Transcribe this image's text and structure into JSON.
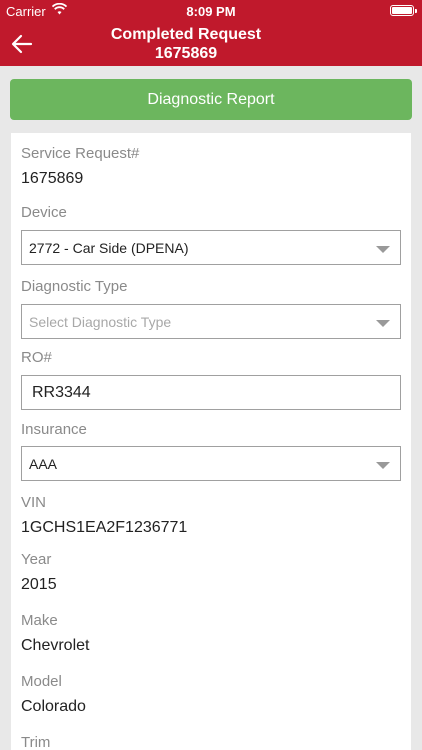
{
  "status_bar": {
    "carrier": "Carrier",
    "time": "8:09 PM"
  },
  "nav": {
    "title_line1": "Completed Request",
    "title_line2": "1675869"
  },
  "actions": {
    "diagnostic_report_label": "Diagnostic Report"
  },
  "form": {
    "service_request": {
      "label": "Service Request#",
      "value": "1675869"
    },
    "device": {
      "label": "Device",
      "value": "2772 - Car Side (DPENA)"
    },
    "diagnostic_type": {
      "label": "Diagnostic Type",
      "placeholder": "Select Diagnostic Type"
    },
    "ro": {
      "label": "RO#",
      "value": "RR3344"
    },
    "insurance": {
      "label": "Insurance",
      "value": "AAA"
    },
    "vin": {
      "label": "VIN",
      "value": "1GCHS1EA2F1236771"
    },
    "year": {
      "label": "Year",
      "value": "2015"
    },
    "make": {
      "label": "Make",
      "value": "Chevrolet"
    },
    "model": {
      "label": "Model",
      "value": "Colorado"
    },
    "trim": {
      "label": "Trim"
    }
  },
  "colors": {
    "brand_red": "#c0192c",
    "action_green": "#6cb65e"
  }
}
